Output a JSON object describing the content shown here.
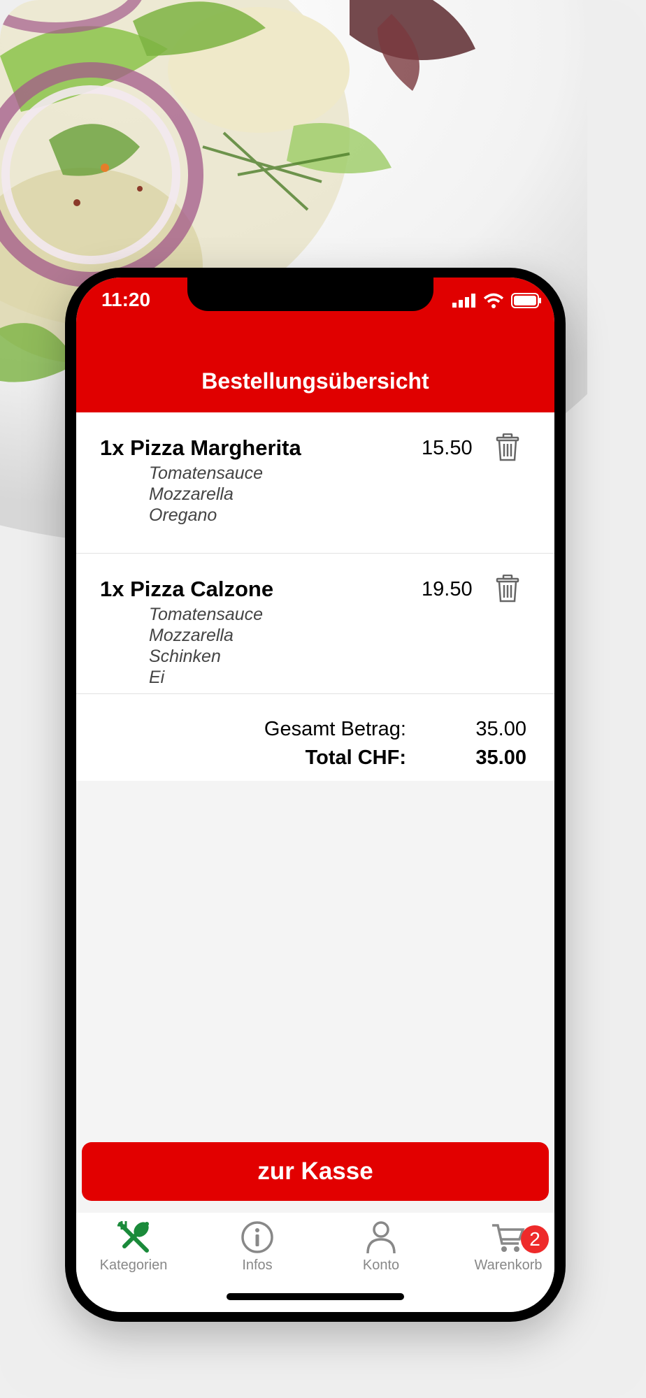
{
  "status_bar": {
    "time": "11:20"
  },
  "header": {
    "title": "Bestellungsübersicht"
  },
  "cart": {
    "items": [
      {
        "title": "1x Pizza Margherita",
        "price": "15.50",
        "ingredients": [
          "Tomatensauce",
          "Mozzarella",
          "Oregano"
        ],
        "icon": "trash-icon"
      },
      {
        "title": "1x Pizza Calzone",
        "price": "19.50",
        "ingredients": [
          "Tomatensauce",
          "Mozzarella",
          "Schinken",
          "Ei"
        ],
        "icon": "trash-icon"
      }
    ]
  },
  "totals": {
    "subtotal_label": "Gesamt Betrag:",
    "subtotal_value": "35.00",
    "total_label": "Total CHF:",
    "total_value": "35.00"
  },
  "checkout": {
    "label": "zur Kasse"
  },
  "tabbar": {
    "tabs": [
      {
        "label": "Kategorien",
        "icon": "cutlery-icon",
        "active": true
      },
      {
        "label": "Infos",
        "icon": "info-icon",
        "active": false
      },
      {
        "label": "Konto",
        "icon": "user-icon",
        "active": false
      },
      {
        "label": "Warenkorb",
        "icon": "cart-icon",
        "active": false,
        "badge": "2"
      }
    ]
  },
  "colors": {
    "brand_red": "#e00000",
    "active_tab": "#1a8a3a",
    "inactive_tab": "#888888",
    "badge": "#ee2a2a"
  }
}
